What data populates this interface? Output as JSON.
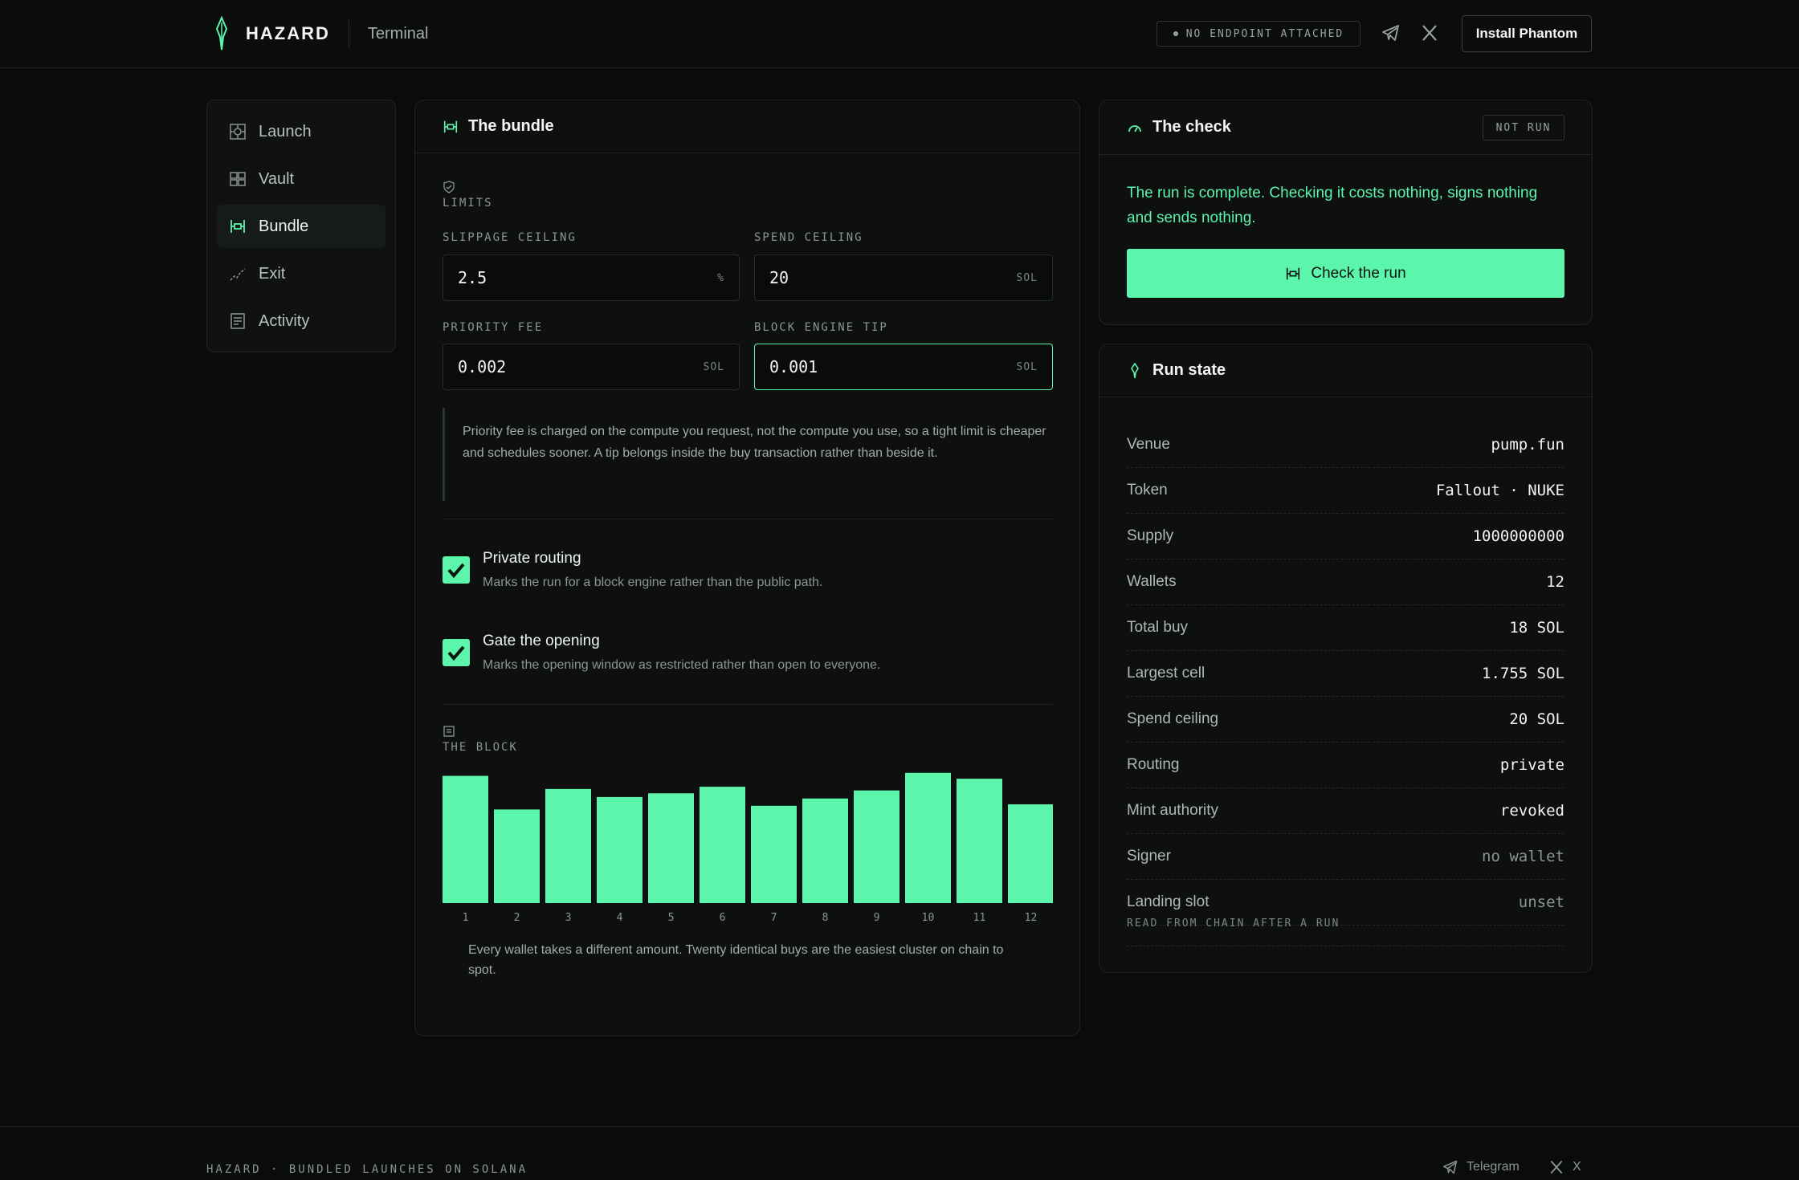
{
  "header": {
    "brand_name": "HAZARD",
    "brand_sub": "Terminal",
    "endpoint_status": "NO ENDPOINT ATTACHED",
    "install_label": "Install Phantom"
  },
  "sidebar": {
    "items": [
      {
        "label": "Launch",
        "icon": "launch-icon"
      },
      {
        "label": "Vault",
        "icon": "vault-icon"
      },
      {
        "label": "Bundle",
        "icon": "bundle-icon",
        "active": true
      },
      {
        "label": "Exit",
        "icon": "exit-icon"
      },
      {
        "label": "Activity",
        "icon": "activity-icon"
      }
    ]
  },
  "bundle": {
    "title": "The bundle",
    "limits_label": "LIMITS",
    "slippage": {
      "label": "SLIPPAGE CEILING",
      "value": "2.5",
      "unit": "%"
    },
    "spend": {
      "label": "SPEND CEILING",
      "value": "20",
      "unit": "SOL"
    },
    "priority": {
      "label": "PRIORITY FEE",
      "value": "0.002",
      "unit": "SOL"
    },
    "tip": {
      "label": "BLOCK ENGINE TIP",
      "value": "0.001",
      "unit": "SOL"
    },
    "note": "Priority fee is charged on the compute you request, not the compute you use, so a tight limit is cheaper and schedules sooner. A tip belongs inside the buy transaction rather than beside it.",
    "private_routing": {
      "title": "Private routing",
      "desc": "Marks the run for a block engine rather than the public path.",
      "checked": true
    },
    "gate_opening": {
      "title": "Gate the opening",
      "desc": "Marks the opening window as restricted rather than open to everyone.",
      "checked": true
    },
    "block_label": "THE BLOCK",
    "chart_note": "Every wallet takes a different amount. Twenty identical buys are the easiest cluster on chain to spot."
  },
  "chart_data": {
    "type": "bar",
    "categories": [
      "1",
      "2",
      "3",
      "4",
      "5",
      "6",
      "7",
      "8",
      "9",
      "10",
      "11",
      "12"
    ],
    "values": [
      1.74,
      1.28,
      1.56,
      1.45,
      1.5,
      1.59,
      1.33,
      1.43,
      1.54,
      1.78,
      1.7,
      1.35
    ],
    "title": "THE BLOCK",
    "color": "#5cf5ac"
  },
  "check": {
    "title": "The check",
    "status": "NOT RUN",
    "message": "The run is complete. Checking it costs nothing, signs nothing and sends nothing.",
    "button_label": "Check the run"
  },
  "run_state": {
    "title": "Run state",
    "rows": [
      {
        "k": "Venue",
        "v": "pump.fun"
      },
      {
        "k": "Token",
        "v": "Fallout · NUKE"
      },
      {
        "k": "Supply",
        "v": "1000000000"
      },
      {
        "k": "Wallets",
        "v": "12"
      },
      {
        "k": "Total buy",
        "v": "18 SOL"
      },
      {
        "k": "Largest cell",
        "v": "1.755 SOL"
      },
      {
        "k": "Spend ceiling",
        "v": "20 SOL"
      },
      {
        "k": "Routing",
        "v": "private"
      },
      {
        "k": "Mint authority",
        "v": "revoked"
      },
      {
        "k": "Signer",
        "v": "no wallet",
        "muted": true
      },
      {
        "k": "Landing slot",
        "v": "unset",
        "muted": true
      }
    ],
    "footnote": "READ FROM CHAIN AFTER A RUN"
  },
  "footer": {
    "text": "HAZARD · BUNDLED LAUNCHES ON SOLANA",
    "telegram": "Telegram",
    "x": "X"
  },
  "colors": {
    "accent": "#5cf5ac",
    "bg": "#0a0c0b"
  }
}
